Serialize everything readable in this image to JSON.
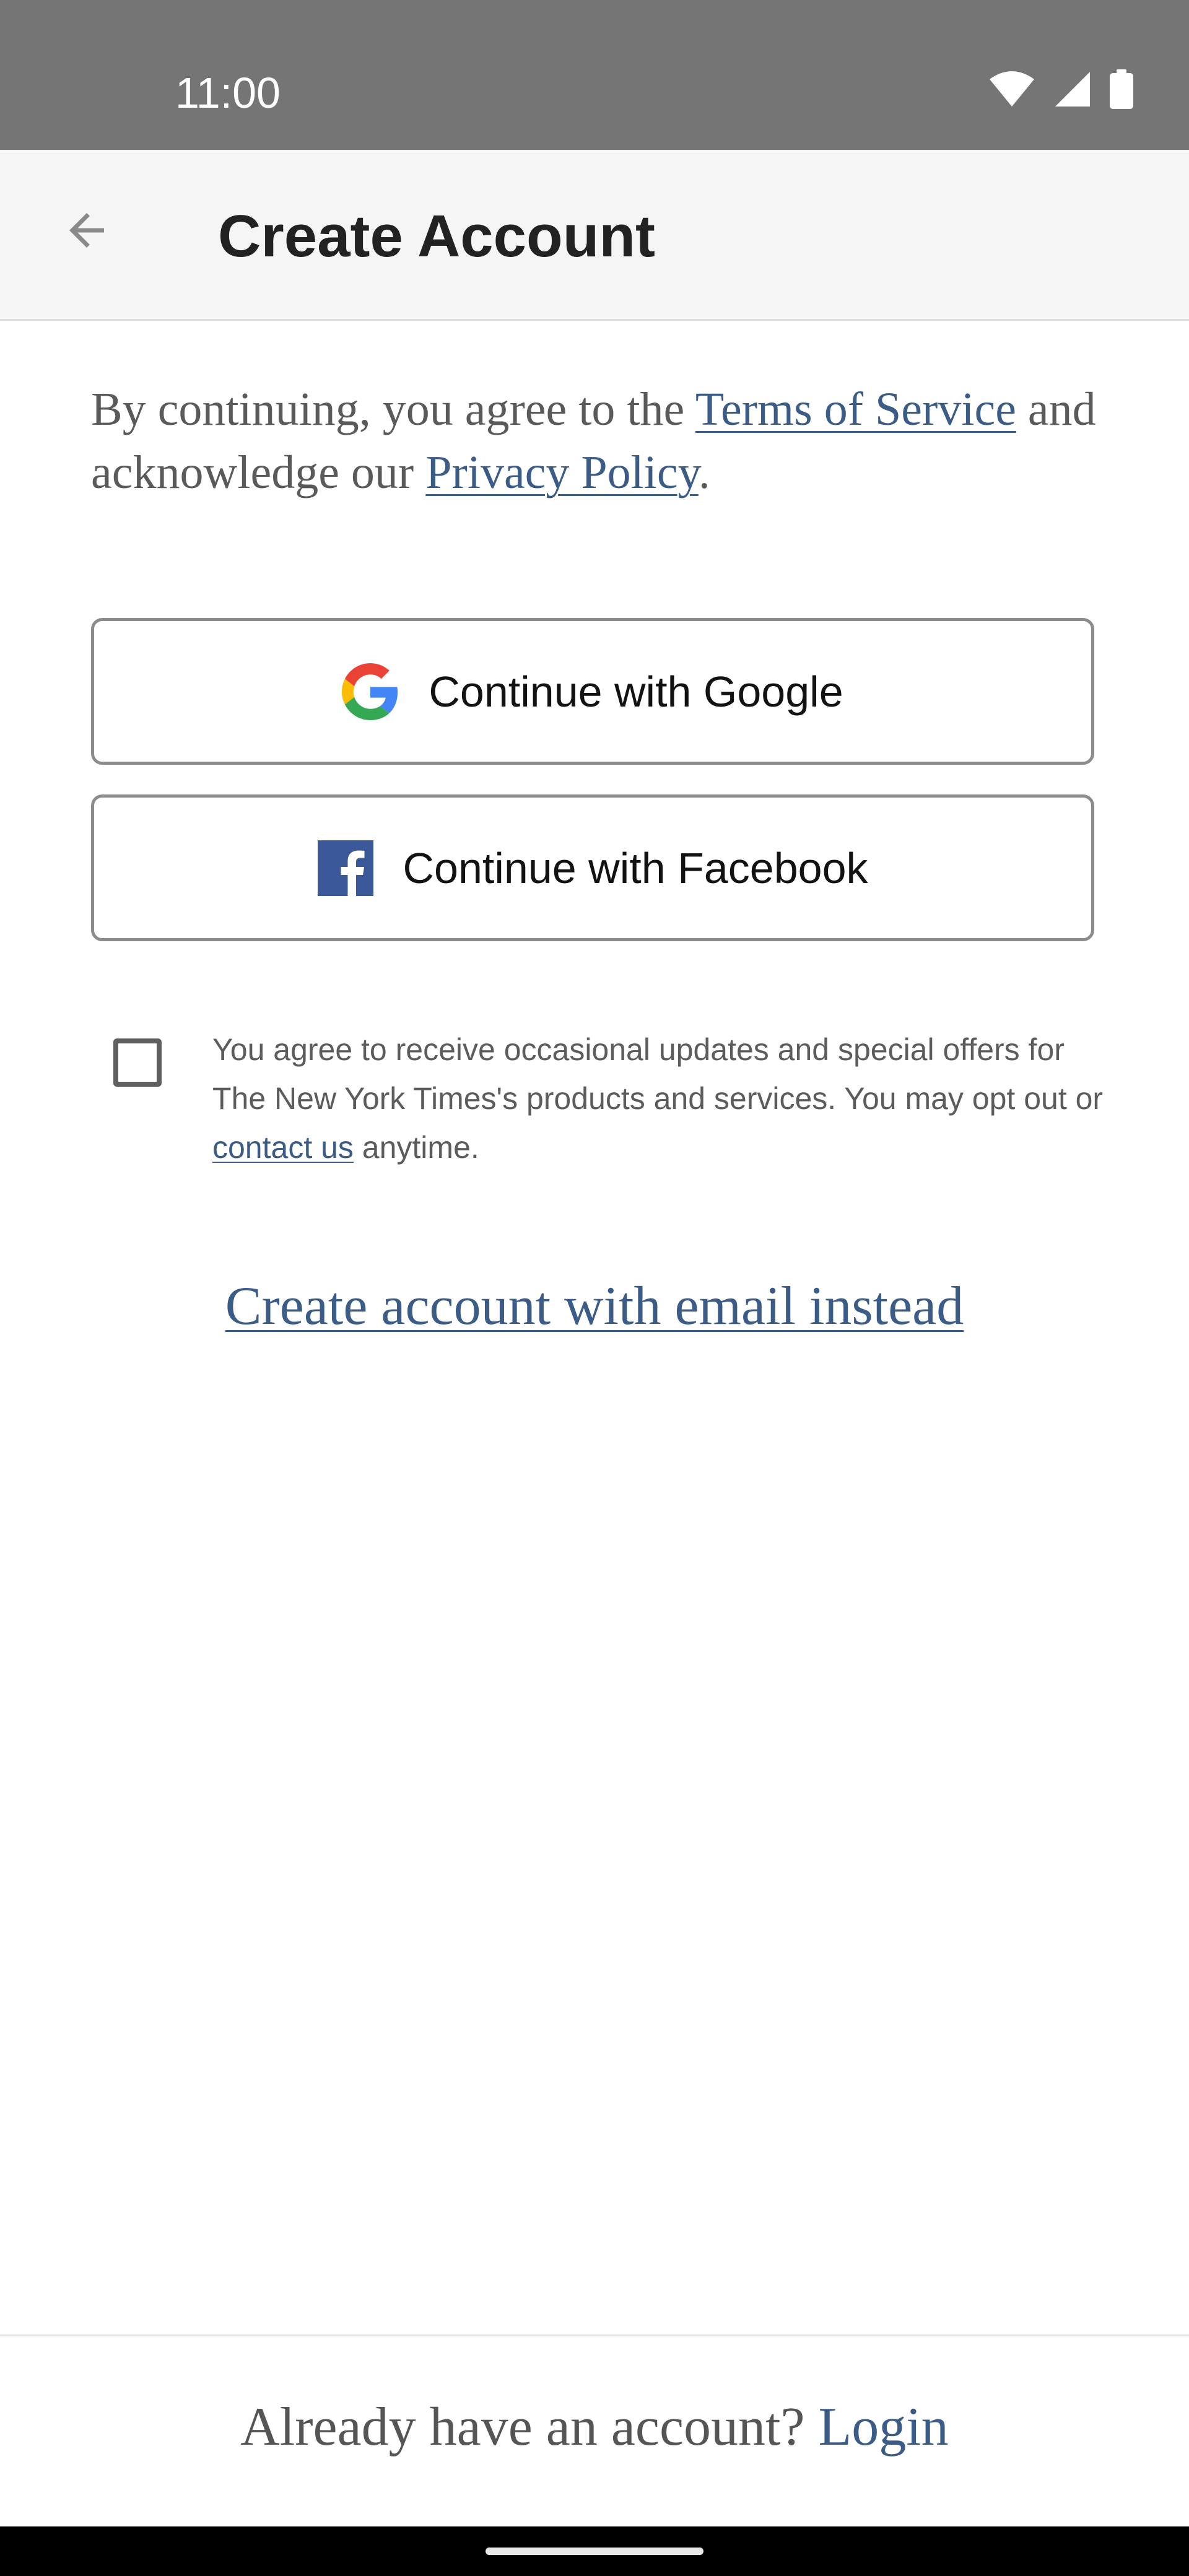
{
  "status_bar": {
    "time": "11:00"
  },
  "app_bar": {
    "title": "Create Account"
  },
  "intro": {
    "prefix": "By continuing, you agree to the ",
    "terms_link": "Terms of Service",
    "middle": " and acknowledge our ",
    "privacy_link": "Privacy Policy",
    "suffix": "."
  },
  "buttons": {
    "google_label": "Continue with Google",
    "facebook_label": "Continue with Facebook"
  },
  "consent": {
    "text_prefix": "You agree to receive occasional updates and special offers for The New York Times's products and services. You may opt out or ",
    "contact_link": "contact us",
    "text_suffix": " anytime.",
    "checked": false
  },
  "email_link": "Create account with email instead",
  "footer": {
    "question": "Already have an account? ",
    "login_link": "Login"
  },
  "colors": {
    "link": "#3a5c87",
    "status_bar": "#757575",
    "app_bar": "#f5f5f5",
    "facebook_blue": "#3b5998"
  },
  "icons": [
    "back-arrow-icon",
    "wifi-icon",
    "signal-icon",
    "battery-icon",
    "google-icon",
    "facebook-icon"
  ]
}
